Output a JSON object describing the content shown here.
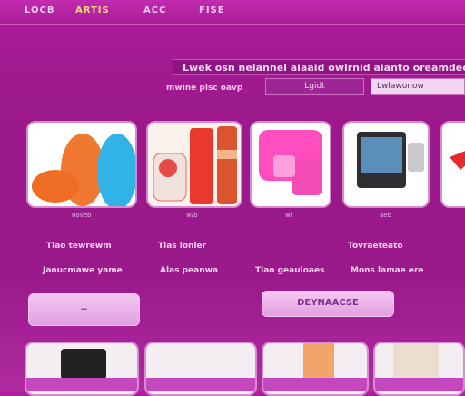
{
  "nav": [
    "LOCB",
    "ARTIS",
    "ACC",
    "FISE"
  ],
  "headline": "Lwek osn nelannel  aiaaid owlrnid aianto oreamdee",
  "filters": {
    "label": "mwine plsc oavp",
    "select1": "Lgidt",
    "select2": "Lwlawonow"
  },
  "products": [
    {
      "caption": "ooveb",
      "icon": "orange-cups"
    },
    {
      "caption": "w/b",
      "icon": "bottles"
    },
    {
      "caption": "wl",
      "icon": "pink-case"
    },
    {
      "caption": "aeb",
      "icon": "device"
    },
    {
      "caption": "",
      "icon": "partial"
    }
  ],
  "columns": {
    "c1": {
      "title": "Tlao tewrewm",
      "subtitle": "Jaoucmawe yame"
    },
    "c2": {
      "title": "Tlas lonler",
      "subtitle": "Alas peanwa"
    },
    "c3": {
      "title": "",
      "subtitle": "Tlao geauloaes"
    },
    "c4": {
      "title": "Tovraeteato",
      "subtitle": "Mons lamae ere"
    }
  },
  "buttons": {
    "left": "~",
    "right": "DEYNAACSE"
  },
  "colors": {
    "accent": "#9a198b",
    "card_border": "#d88ad2",
    "button": "#f6c8f1"
  }
}
